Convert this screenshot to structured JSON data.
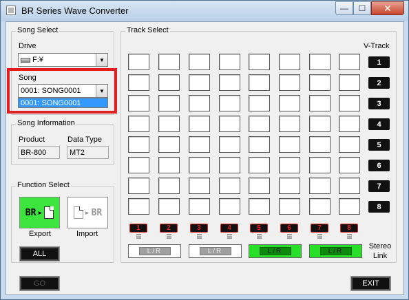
{
  "window": {
    "title": "BR Series Wave Converter",
    "minimize_glyph": "—",
    "maximize_glyph": "☐",
    "close_glyph": "✕"
  },
  "song_select": {
    "group_title": "Song Select",
    "drive_label": "Drive",
    "drive_value": "F:¥",
    "song_label": "Song",
    "song_value": "0001: SONG0001",
    "dropdown_items": [
      "0001: SONG0001"
    ]
  },
  "song_information": {
    "group_title": "Song Information",
    "product_label": "Product",
    "product_value": "BR-800",
    "datatype_label": "Data Type",
    "datatype_value": "MT2"
  },
  "function_select": {
    "group_title": "Function Select",
    "export_label": "Export",
    "import_label": "Import",
    "export_icon_text": "BR",
    "import_icon_text": "BR",
    "all_label": "ALL"
  },
  "track_select": {
    "group_title": "Track Select",
    "vtrack_label": "V-Track",
    "vtracks": [
      "1",
      "2",
      "3",
      "4",
      "5",
      "6",
      "7",
      "8"
    ],
    "tracks": [
      "1",
      "2",
      "3",
      "4",
      "5",
      "6",
      "7",
      "8"
    ],
    "stereo_link_label_line1": "Stereo",
    "stereo_link_label_line2": "Link",
    "stereo_links": [
      {
        "label": "L/R",
        "active": false
      },
      {
        "label": "L/R",
        "active": false
      },
      {
        "label": "L/R",
        "active": true
      },
      {
        "label": "L/R",
        "active": true
      }
    ]
  },
  "footer": {
    "go_label": "GO",
    "exit_label": "EXIT"
  },
  "colors": {
    "active_green": "#29e029",
    "highlight_red": "#e02020",
    "selection_blue": "#3399ff"
  }
}
